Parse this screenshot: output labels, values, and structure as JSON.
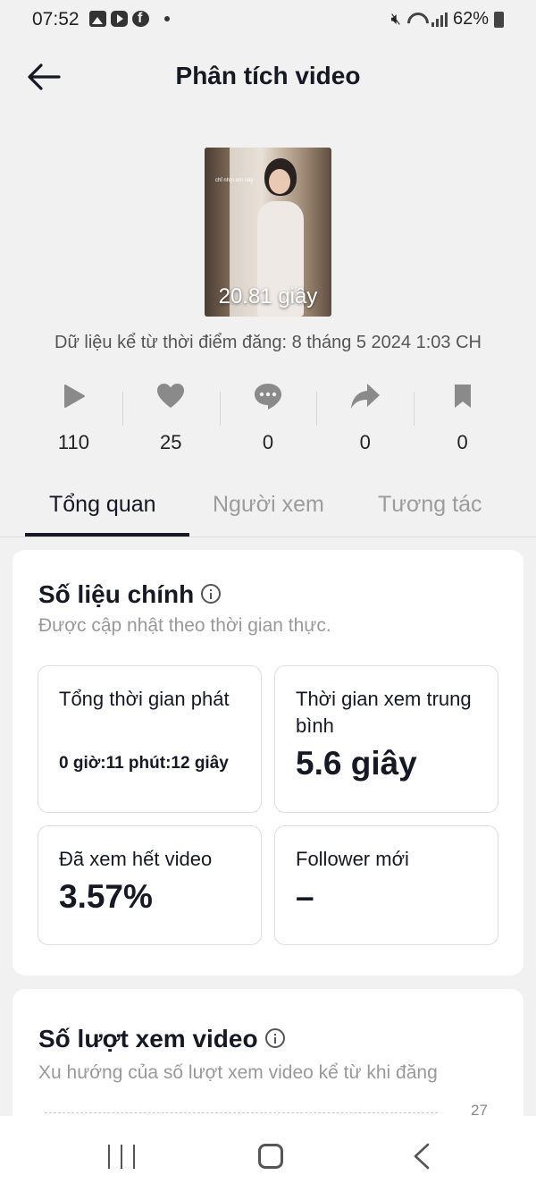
{
  "status_bar": {
    "time": "07:52",
    "battery": "62%",
    "left_icons": [
      "gallery-icon",
      "youtube-icon",
      "facebook-icon",
      "dot-icon"
    ],
    "right_icons": [
      "mute-icon",
      "wifi-icon",
      "signal-icon",
      "battery-icon"
    ]
  },
  "header": {
    "title": "Phân tích video",
    "back_icon": "arrow-left-icon"
  },
  "video": {
    "thumbnail_caption": "chỉ nhìn em này",
    "duration": "20.81 giây",
    "posted_info": "Dữ liệu kể từ thời điểm đăng: 8 tháng 5 2024 1:03 CH"
  },
  "stats": [
    {
      "icon": "play-icon",
      "value": "110"
    },
    {
      "icon": "heart-icon",
      "value": "25"
    },
    {
      "icon": "comment-icon",
      "value": "0"
    },
    {
      "icon": "share-icon",
      "value": "0"
    },
    {
      "icon": "bookmark-icon",
      "value": "0"
    }
  ],
  "tabs": [
    {
      "label": "Tổng quan",
      "active": true
    },
    {
      "label": "Người xem",
      "active": false
    },
    {
      "label": "Tương tác",
      "active": false
    }
  ],
  "key_metrics": {
    "title": "Số liệu chính",
    "subtitle": "Được cập nhật theo thời gian thực.",
    "items": [
      {
        "label": "Tổng thời gian phát",
        "value": "0 giờ:11 phút:12 giây"
      },
      {
        "label": "Thời gian xem trung bình",
        "value": "5.6 giây"
      },
      {
        "label": "Đã xem hết video",
        "value": "3.57%"
      },
      {
        "label": "Follower mới",
        "value": "–"
      }
    ]
  },
  "video_views": {
    "title": "Số lượt xem video",
    "subtitle": "Xu hướng của số lượt xem video kể từ khi đăng",
    "chart_top_tick": "27"
  },
  "colors": {
    "background": "#f1f1f1",
    "card": "#ffffff",
    "text_primary": "#161823",
    "text_secondary": "#999999",
    "icon_gray": "#8a8a8a"
  },
  "navbar": [
    "recents-icon",
    "home-icon",
    "back-icon"
  ]
}
